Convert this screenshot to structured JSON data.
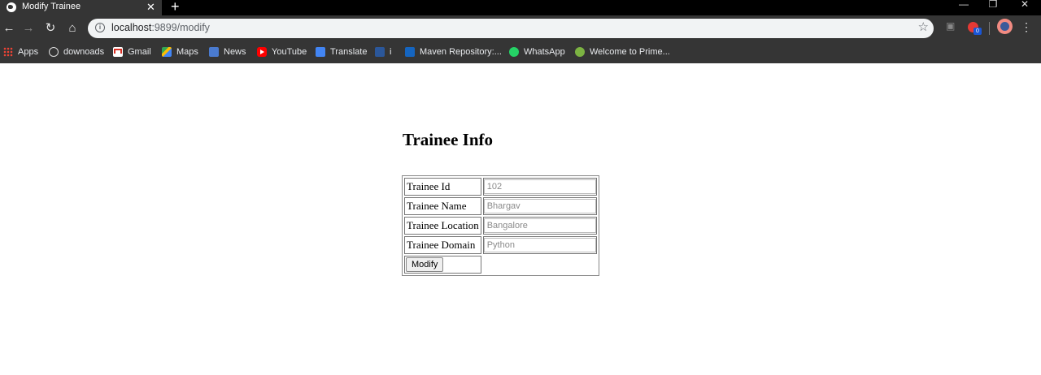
{
  "browser": {
    "tab_title": "Modify Trainee",
    "tab_close": "✕",
    "new_tab": "+",
    "url_host": "localhost",
    "url_rest": ":9899/modify",
    "window_controls": {
      "minimize": "—",
      "restore": "❐",
      "close": "✕"
    },
    "extension_badge": "0",
    "bookmarks": [
      {
        "label": "Apps",
        "icon": "apps-icon"
      },
      {
        "label": "downoads",
        "icon": "history-icon"
      },
      {
        "label": "Gmail",
        "icon": "gmail-icon"
      },
      {
        "label": "Maps",
        "icon": "maps-icon"
      },
      {
        "label": "News",
        "icon": "news-icon"
      },
      {
        "label": "YouTube",
        "icon": "youtube-icon"
      },
      {
        "label": "Translate",
        "icon": "translate-icon"
      },
      {
        "label": "i",
        "icon": "word-icon"
      },
      {
        "label": "Maven Repository:...",
        "icon": "maven-icon"
      },
      {
        "label": "WhatsApp",
        "icon": "whatsapp-icon"
      },
      {
        "label": "Welcome to Prime...",
        "icon": "prime-icon"
      }
    ]
  },
  "page": {
    "heading": "Trainee Info",
    "fields": [
      {
        "label": "Trainee Id",
        "placeholder": "102"
      },
      {
        "label": "Trainee Name",
        "placeholder": "Bhargav"
      },
      {
        "label": "Trainee Location",
        "placeholder": "Bangalore"
      },
      {
        "label": "Trainee Domain",
        "placeholder": "Python"
      }
    ],
    "submit_label": "Modify"
  }
}
